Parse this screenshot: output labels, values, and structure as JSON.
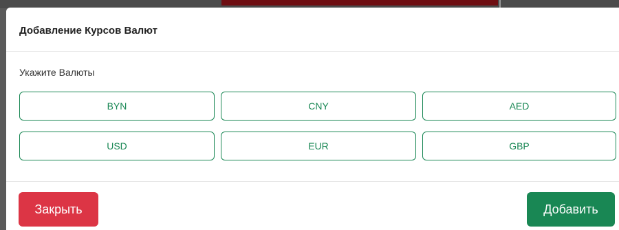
{
  "colors": {
    "accent_green": "#198754",
    "danger_red": "#dc3545"
  },
  "modal": {
    "title": "Добавление Курсов Валют",
    "section_label": "Укажите Валюты",
    "currencies": [
      "BYN",
      "CNY",
      "AED",
      "USD",
      "EUR",
      "GBP"
    ],
    "close_label": "Закрыть",
    "add_label": "Добавить"
  }
}
